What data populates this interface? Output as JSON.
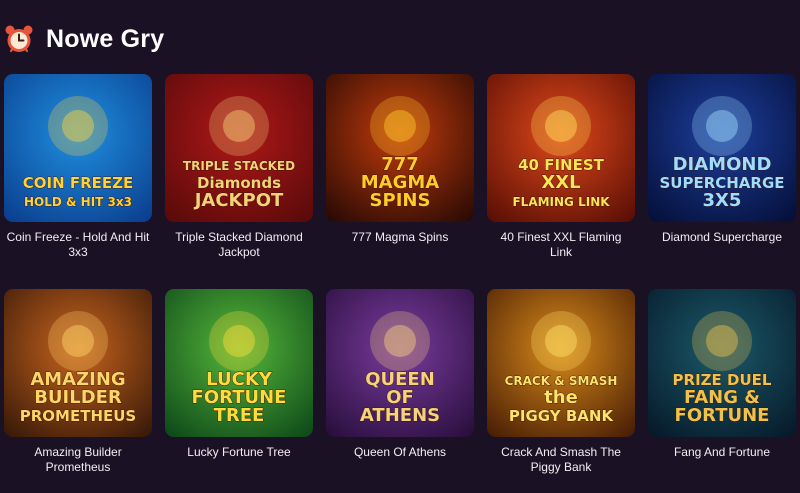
{
  "section": {
    "title": "Nowe Gry",
    "icon": "alarm-clock-icon",
    "accent": "#e8553a"
  },
  "games": [
    {
      "name": "Coin Freeze - Hold And Hit 3x3",
      "art_lines": [
        "COIN FREEZE",
        "HOLD & HIT 3x3"
      ],
      "bg": [
        "#0b3f8f",
        "#1f8fe0"
      ],
      "art_color": "#ffd23a"
    },
    {
      "name": "Triple Stacked Diamond Jackpot",
      "art_lines": [
        "TRIPLE STACKED",
        "Diamonds",
        "JACKPOT"
      ],
      "bg": [
        "#5a0a0a",
        "#b01818"
      ],
      "art_color": "#f3d27a"
    },
    {
      "name": "777 Magma Spins",
      "art_lines": [
        "777",
        "MAGMA",
        "SPINS"
      ],
      "bg": [
        "#2a0a04",
        "#c23b0c"
      ],
      "art_color": "#ffcc2a"
    },
    {
      "name": "40 Finest XXL Flaming Link",
      "art_lines": [
        "40 FINEST",
        "XXL",
        "FLAMING LINK"
      ],
      "bg": [
        "#5a0f05",
        "#e0481a"
      ],
      "art_color": "#ffe45a"
    },
    {
      "name": "Diamond Supercharge",
      "art_lines": [
        "DIAMOND",
        "SUPERCHARGE",
        "3X5"
      ],
      "bg": [
        "#05103a",
        "#1d3f9e"
      ],
      "art_color": "#9fdcff"
    },
    {
      "name": "Amazing Builder Prometheus",
      "art_lines": [
        "AMAZING",
        "BUILDER",
        "PROMETHEUS"
      ],
      "bg": [
        "#3a1a08",
        "#c8641e"
      ],
      "art_color": "#ffd56a"
    },
    {
      "name": "Lucky Fortune Tree",
      "art_lines": [
        "LUCKY",
        "FORTUNE",
        "TREE"
      ],
      "bg": [
        "#0f4a1a",
        "#56b83a"
      ],
      "art_color": "#ffdc3a"
    },
    {
      "name": "Queen Of Athens",
      "art_lines": [
        "QUEEN",
        "OF",
        "ATHENS"
      ],
      "bg": [
        "#2a0f3e",
        "#7a3b9e"
      ],
      "art_color": "#f6d27a"
    },
    {
      "name": "Crack And Smash The Piggy Bank",
      "art_lines": [
        "CRACK & SMASH",
        "the",
        "PIGGY BANK"
      ],
      "bg": [
        "#4a1f05",
        "#d98a1a"
      ],
      "art_color": "#ffe36a"
    },
    {
      "name": "Fang And Fortune",
      "art_lines": [
        "PRIZE DUEL",
        "FANG &",
        "FORTUNE"
      ],
      "bg": [
        "#061a2a",
        "#1c5a6a"
      ],
      "art_color": "#f0c24a"
    }
  ]
}
